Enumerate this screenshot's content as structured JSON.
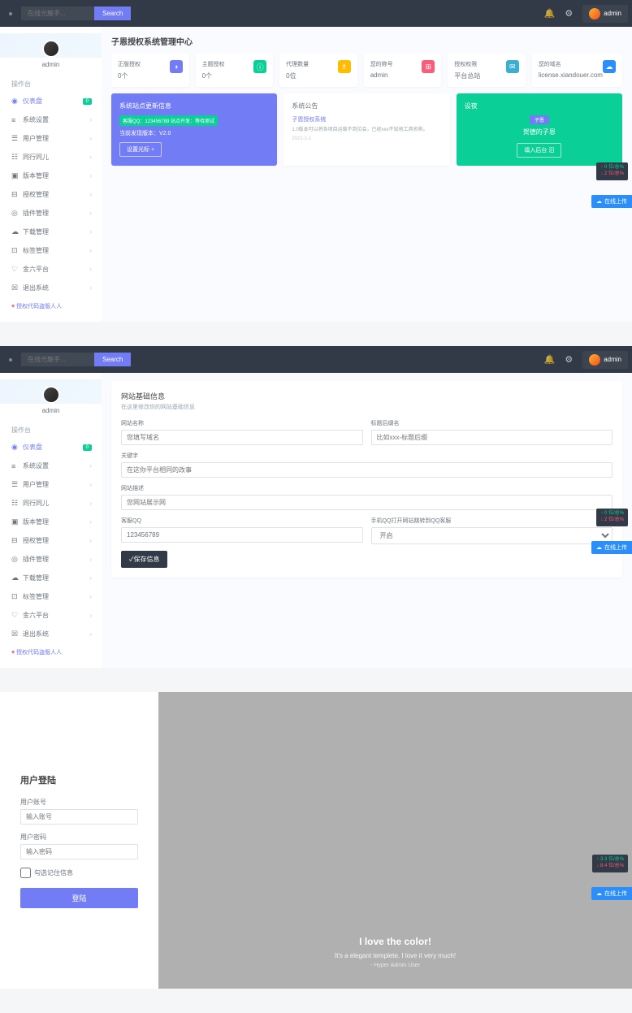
{
  "topbar": {
    "search_placeholder": "在线光触手...",
    "search_btn": "Search",
    "user_name": "admin"
  },
  "sidebar": {
    "user": "admin",
    "section": "操作台",
    "footer": "授权代码盗版人人",
    "badge": "0",
    "items": [
      {
        "icon": "◉",
        "label": "仪表盘",
        "active": true,
        "badge": true
      },
      {
        "icon": "≡",
        "label": "系统设置"
      },
      {
        "icon": "☰",
        "label": "用户管理"
      },
      {
        "icon": "☷",
        "label": "同行同儿"
      },
      {
        "icon": "▣",
        "label": "版本管理"
      },
      {
        "icon": "⊟",
        "label": "授权管理"
      },
      {
        "icon": "◎",
        "label": "插件管理"
      },
      {
        "icon": "☁",
        "label": "下载管理"
      },
      {
        "icon": "⊡",
        "label": "标签管理"
      },
      {
        "icon": "♡",
        "label": "金六平台"
      },
      {
        "icon": "☒",
        "label": "退出系统"
      }
    ]
  },
  "dashboard": {
    "title": "子恩授权系统管理中心",
    "stats": [
      {
        "label": "正版授权",
        "value": "0个",
        "color": "ic-purple",
        "icon": "◑"
      },
      {
        "label": "主题授权",
        "value": "0个",
        "color": "ic-green",
        "icon": "ⓘ"
      },
      {
        "label": "代理数量",
        "value": "0位",
        "color": "ic-orange",
        "icon": "♗"
      },
      {
        "label": "您的称号",
        "value": "admin",
        "color": "ic-red",
        "icon": "⊞"
      },
      {
        "label": "授权权限",
        "value": "平台总站",
        "color": "ic-teal",
        "icon": "✉"
      },
      {
        "label": "您的域名",
        "value": "license.xiandouer.com",
        "color": "ic-blue",
        "icon": "☁"
      }
    ],
    "card1": {
      "title": "系统站点更新信息",
      "sub": "客服QQ：123456789    站点开发：等待测试",
      "ver": "当前发现版本：V2.0",
      "btn": "设置光标  +"
    },
    "card2": {
      "title": "系统公告",
      "link": "子恩授权系统",
      "desc": "1.0版本可以将各项目运维不到位会，已经xxx不知地工具名称。",
      "date": "2021-1-1"
    },
    "card3": {
      "title": "设夜",
      "tag": "子恩",
      "subject": "贺德的子恩",
      "btn": "填入后台  汩"
    }
  },
  "float1": {
    "up": "↑ 0 位/总%",
    "down": "↓ 2 位/总%"
  },
  "float_btn": "在线上传",
  "form": {
    "title": "网站基础信息",
    "sub": "在这里修改你的网站基础信息",
    "fields": {
      "site_name_label": "网站名称",
      "site_name_ph": "您填写域名",
      "title_suffix_label": "标题后缀名",
      "title_suffix_ph": "比如xxx-标题后缀",
      "keywords_label": "关键字",
      "keywords_ph": "在这你平台相同的改事",
      "desc_label": "网站描述",
      "desc_ph": "您网站展示网",
      "qq_label": "客服QQ",
      "qq_value": "123456789",
      "mobile_label": "手机QQ打开网站跳转到QQ客服",
      "mobile_value": "开启"
    },
    "submit": "✓保存信息"
  },
  "float2": {
    "up": "↑ 0 位/总%",
    "down": "↓ 2 位/总%"
  },
  "login": {
    "title": "用户登陆",
    "user_label": "用户账号",
    "user_ph": "输入账号",
    "pass_label": "用户密码",
    "pass_ph": "输入密码",
    "remember": "勾选记住信息",
    "btn": "登陆",
    "right_title": "I love the color!",
    "right_quote": "It's a elegant templete. I love it very much!",
    "right_author": "- Hyper Admin User"
  },
  "float3": {
    "up": "↑ 3.3 位/总%",
    "down": "↓ 8.4 位/总%"
  }
}
